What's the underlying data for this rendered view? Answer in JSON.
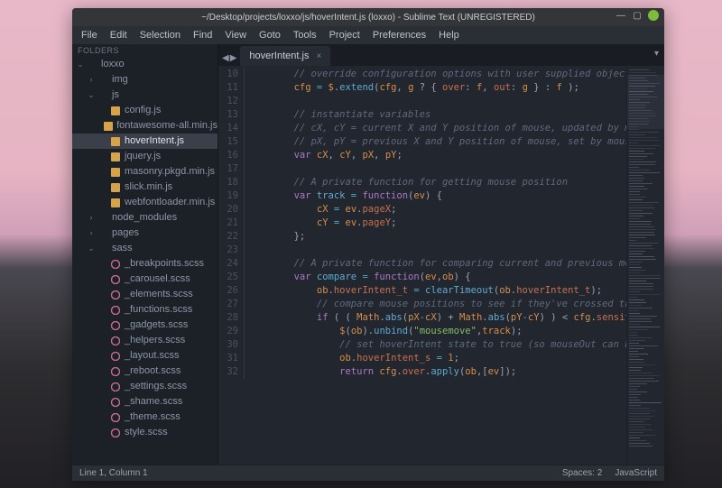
{
  "title": "~/Desktop/projects/loxxo/js/hoverIntent.js (loxxo) - Sublime Text (UNREGISTERED)",
  "menu": [
    "File",
    "Edit",
    "Selection",
    "Find",
    "View",
    "Goto",
    "Tools",
    "Project",
    "Preferences",
    "Help"
  ],
  "sidebar": {
    "header": "FOLDERS",
    "tree": [
      {
        "d": 0,
        "t": "dir",
        "open": true,
        "label": "loxxo"
      },
      {
        "d": 1,
        "t": "dir",
        "open": false,
        "label": "img"
      },
      {
        "d": 1,
        "t": "dir",
        "open": true,
        "label": "js"
      },
      {
        "d": 2,
        "t": "js",
        "label": "config.js"
      },
      {
        "d": 2,
        "t": "js",
        "label": "fontawesome-all.min.js"
      },
      {
        "d": 2,
        "t": "js",
        "label": "hoverIntent.js",
        "sel": true
      },
      {
        "d": 2,
        "t": "js",
        "label": "jquery.js"
      },
      {
        "d": 2,
        "t": "js",
        "label": "masonry.pkgd.min.js"
      },
      {
        "d": 2,
        "t": "js",
        "label": "slick.min.js"
      },
      {
        "d": 2,
        "t": "js",
        "label": "webfontloader.min.js"
      },
      {
        "d": 1,
        "t": "dir",
        "open": false,
        "label": "node_modules"
      },
      {
        "d": 1,
        "t": "dir",
        "open": false,
        "label": "pages"
      },
      {
        "d": 1,
        "t": "dir",
        "open": true,
        "label": "sass"
      },
      {
        "d": 2,
        "t": "sass",
        "label": "_breakpoints.scss"
      },
      {
        "d": 2,
        "t": "sass",
        "label": "_carousel.scss"
      },
      {
        "d": 2,
        "t": "sass",
        "label": "_elements.scss"
      },
      {
        "d": 2,
        "t": "sass",
        "label": "_functions.scss"
      },
      {
        "d": 2,
        "t": "sass",
        "label": "_gadgets.scss"
      },
      {
        "d": 2,
        "t": "sass",
        "label": "_helpers.scss"
      },
      {
        "d": 2,
        "t": "sass",
        "label": "_layout.scss"
      },
      {
        "d": 2,
        "t": "sass",
        "label": "_reboot.scss"
      },
      {
        "d": 2,
        "t": "sass",
        "label": "_settings.scss"
      },
      {
        "d": 2,
        "t": "sass",
        "label": "_shame.scss"
      },
      {
        "d": 2,
        "t": "sass",
        "label": "_theme.scss"
      },
      {
        "d": 2,
        "t": "sass",
        "label": "style.scss"
      }
    ]
  },
  "tabs": {
    "arrows": {
      "left": "◀",
      "right": "▶"
    },
    "active": {
      "label": "hoverIntent.js",
      "close": "×"
    },
    "dropdown": "▾"
  },
  "code": {
    "first_line": 10,
    "lines": [
      [
        [
          "// override configuration options with user supplied object",
          "c-comment"
        ]
      ],
      [
        [
          "cfg",
          "c-id"
        ],
        [
          " = ",
          "c-op"
        ],
        [
          "$",
          "c-id"
        ],
        [
          ".",
          "c-punc"
        ],
        [
          "extend",
          "c-func"
        ],
        [
          "(",
          "c-punc"
        ],
        [
          "cfg",
          "c-id"
        ],
        [
          ", ",
          "c-punc"
        ],
        [
          "g",
          "c-id"
        ],
        [
          " ? { ",
          "c-punc"
        ],
        [
          "over",
          "c-prop"
        ],
        [
          ": ",
          "c-punc"
        ],
        [
          "f",
          "c-id"
        ],
        [
          ", ",
          "c-punc"
        ],
        [
          "out",
          "c-prop"
        ],
        [
          ": ",
          "c-punc"
        ],
        [
          "g",
          "c-id"
        ],
        [
          " } : ",
          "c-punc"
        ],
        [
          "f",
          "c-id"
        ],
        [
          " );",
          "c-punc"
        ]
      ],
      [],
      [
        [
          "// instantiate variables",
          "c-comment"
        ]
      ],
      [
        [
          "// cX, cY = current X and Y position of mouse, updated by mous",
          "c-comment"
        ]
      ],
      [
        [
          "// pX, pY = previous X and Y position of mouse, set by mouseov",
          "c-comment"
        ]
      ],
      [
        [
          "var",
          "c-storage"
        ],
        [
          " ",
          ""
        ],
        [
          "cX",
          "c-id"
        ],
        [
          ", ",
          "c-punc"
        ],
        [
          "cY",
          "c-id"
        ],
        [
          ", ",
          "c-punc"
        ],
        [
          "pX",
          "c-id"
        ],
        [
          ", ",
          "c-punc"
        ],
        [
          "pY",
          "c-id"
        ],
        [
          ";",
          "c-punc"
        ]
      ],
      [],
      [
        [
          "// A private function for getting mouse position",
          "c-comment"
        ]
      ],
      [
        [
          "var",
          "c-storage"
        ],
        [
          " ",
          ""
        ],
        [
          "track",
          "c-func"
        ],
        [
          " = ",
          "c-op"
        ],
        [
          "function",
          "c-storage"
        ],
        [
          "(",
          "c-punc"
        ],
        [
          "ev",
          "c-id"
        ],
        [
          ") {",
          "c-punc"
        ]
      ],
      [
        [
          "    ",
          ""
        ],
        [
          "cX",
          "c-id"
        ],
        [
          " = ",
          "c-op"
        ],
        [
          "ev",
          "c-id"
        ],
        [
          ".",
          "c-punc"
        ],
        [
          "pageX",
          "c-prop"
        ],
        [
          ";",
          "c-punc"
        ]
      ],
      [
        [
          "    ",
          ""
        ],
        [
          "cY",
          "c-id"
        ],
        [
          " = ",
          "c-op"
        ],
        [
          "ev",
          "c-id"
        ],
        [
          ".",
          "c-punc"
        ],
        [
          "pageY",
          "c-prop"
        ],
        [
          ";",
          "c-punc"
        ]
      ],
      [
        [
          "};",
          "c-punc"
        ]
      ],
      [],
      [
        [
          "// A private function for comparing current and previous mouse",
          "c-comment"
        ]
      ],
      [
        [
          "var",
          "c-storage"
        ],
        [
          " ",
          ""
        ],
        [
          "compare",
          "c-func"
        ],
        [
          " = ",
          "c-op"
        ],
        [
          "function",
          "c-storage"
        ],
        [
          "(",
          "c-punc"
        ],
        [
          "ev",
          "c-id"
        ],
        [
          ",",
          "c-punc"
        ],
        [
          "ob",
          "c-id"
        ],
        [
          ") {",
          "c-punc"
        ]
      ],
      [
        [
          "    ",
          ""
        ],
        [
          "ob",
          "c-id"
        ],
        [
          ".",
          "c-punc"
        ],
        [
          "hoverIntent_t",
          "c-prop"
        ],
        [
          " = ",
          "c-op"
        ],
        [
          "clearTimeout",
          "c-func"
        ],
        [
          "(",
          "c-punc"
        ],
        [
          "ob",
          "c-id"
        ],
        [
          ".",
          "c-punc"
        ],
        [
          "hoverIntent_t",
          "c-prop"
        ],
        [
          ");",
          "c-punc"
        ]
      ],
      [
        [
          "    ",
          ""
        ],
        [
          "// compare mouse positions to see if they've crossed the thr",
          "c-comment"
        ]
      ],
      [
        [
          "    ",
          ""
        ],
        [
          "if",
          "c-key"
        ],
        [
          " ( ( ",
          "c-punc"
        ],
        [
          "Math",
          "c-id"
        ],
        [
          ".",
          "c-punc"
        ],
        [
          "abs",
          "c-func"
        ],
        [
          "(",
          "c-punc"
        ],
        [
          "pX",
          "c-id"
        ],
        [
          "-",
          "c-op"
        ],
        [
          "cX",
          "c-id"
        ],
        [
          ") + ",
          "c-punc"
        ],
        [
          "Math",
          "c-id"
        ],
        [
          ".",
          "c-punc"
        ],
        [
          "abs",
          "c-func"
        ],
        [
          "(",
          "c-punc"
        ],
        [
          "pY",
          "c-id"
        ],
        [
          "-",
          "c-op"
        ],
        [
          "cY",
          "c-id"
        ],
        [
          ") ) < ",
          "c-punc"
        ],
        [
          "cfg",
          "c-id"
        ],
        [
          ".",
          "c-punc"
        ],
        [
          "sensitivity",
          "c-prop"
        ]
      ],
      [
        [
          "        ",
          ""
        ],
        [
          "$",
          "c-id"
        ],
        [
          "(",
          "c-punc"
        ],
        [
          "ob",
          "c-id"
        ],
        [
          ").",
          "c-punc"
        ],
        [
          "unbind",
          "c-func"
        ],
        [
          "(",
          "c-punc"
        ],
        [
          "\"mousemove\"",
          "c-str"
        ],
        [
          ",",
          "c-punc"
        ],
        [
          "track",
          "c-id"
        ],
        [
          ");",
          "c-punc"
        ]
      ],
      [
        [
          "        ",
          ""
        ],
        [
          "// set hoverIntent state to true (so mouseOut can be calle",
          "c-comment"
        ]
      ],
      [
        [
          "        ",
          ""
        ],
        [
          "ob",
          "c-id"
        ],
        [
          ".",
          "c-punc"
        ],
        [
          "hoverIntent_s",
          "c-prop"
        ],
        [
          " = ",
          "c-op"
        ],
        [
          "1",
          "c-num"
        ],
        [
          ";",
          "c-punc"
        ]
      ],
      [
        [
          "        ",
          ""
        ],
        [
          "return",
          "c-key"
        ],
        [
          " ",
          ""
        ],
        [
          "cfg",
          "c-id"
        ],
        [
          ".",
          "c-punc"
        ],
        [
          "over",
          "c-prop"
        ],
        [
          ".",
          "c-punc"
        ],
        [
          "apply",
          "c-func"
        ],
        [
          "(",
          "c-punc"
        ],
        [
          "ob",
          "c-id"
        ],
        [
          ",[",
          "c-punc"
        ],
        [
          "ev",
          "c-id"
        ],
        [
          "]);",
          "c-punc"
        ]
      ]
    ],
    "base_indent": 2
  },
  "status": {
    "left": "Line 1, Column 1",
    "spaces": "Spaces: 2",
    "lang": "JavaScript"
  }
}
